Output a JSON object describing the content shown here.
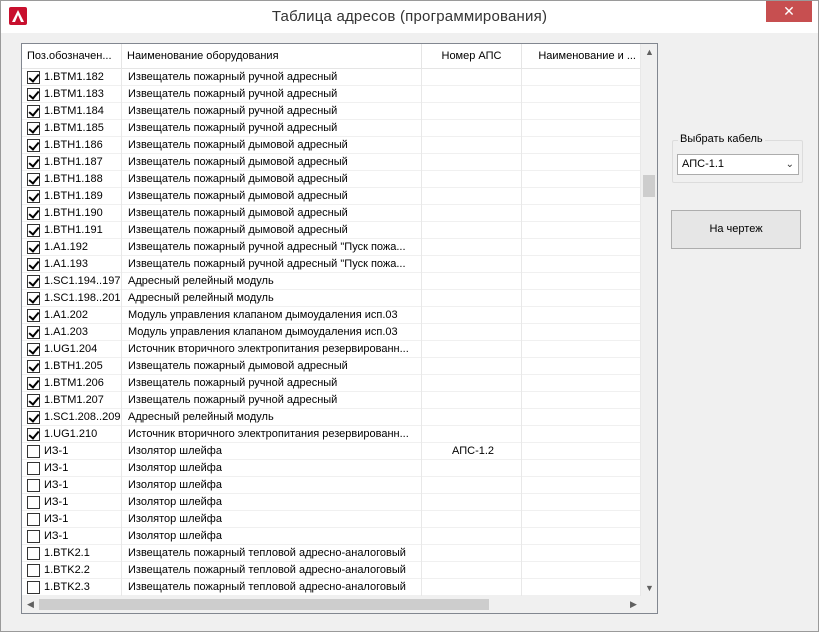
{
  "window": {
    "title": "Таблица адресов (программирования)",
    "close_glyph": "✕",
    "app_icon": "autocad-icon"
  },
  "columns": [
    "Поз.обозначен...",
    "Наименование оборудования",
    "Номер АПС",
    "Наименование и ..."
  ],
  "rows": [
    {
      "checked": true,
      "pos": "1.BTM1.182",
      "name": "Извещатель пожарный ручной адресный",
      "aps": "",
      "desc": ""
    },
    {
      "checked": true,
      "pos": "1.BTM1.183",
      "name": "Извещатель пожарный ручной адресный",
      "aps": "",
      "desc": ""
    },
    {
      "checked": true,
      "pos": "1.BTM1.184",
      "name": "Извещатель пожарный ручной адресный",
      "aps": "",
      "desc": ""
    },
    {
      "checked": true,
      "pos": "1.BTM1.185",
      "name": "Извещатель пожарный ручной адресный",
      "aps": "",
      "desc": ""
    },
    {
      "checked": true,
      "pos": "1.BTH1.186",
      "name": "Извещатель пожарный дымовой адресный",
      "aps": "",
      "desc": ""
    },
    {
      "checked": true,
      "pos": "1.BTH1.187",
      "name": "Извещатель пожарный дымовой адресный",
      "aps": "",
      "desc": ""
    },
    {
      "checked": true,
      "pos": "1.BTH1.188",
      "name": "Извещатель пожарный дымовой адресный",
      "aps": "",
      "desc": ""
    },
    {
      "checked": true,
      "pos": "1.BTH1.189",
      "name": "Извещатель пожарный дымовой адресный",
      "aps": "",
      "desc": ""
    },
    {
      "checked": true,
      "pos": "1.BTH1.190",
      "name": "Извещатель пожарный дымовой адресный",
      "aps": "",
      "desc": ""
    },
    {
      "checked": true,
      "pos": "1.BTH1.191",
      "name": "Извещатель пожарный дымовой адресный",
      "aps": "",
      "desc": ""
    },
    {
      "checked": true,
      "pos": "1.A1.192",
      "name": "Извещатель пожарный ручной адресный  \"Пуск пожа...",
      "aps": "",
      "desc": ""
    },
    {
      "checked": true,
      "pos": "1.A1.193",
      "name": "Извещатель пожарный ручной адресный  \"Пуск пожа...",
      "aps": "",
      "desc": ""
    },
    {
      "checked": true,
      "pos": "1.SC1.194..197",
      "name": "Адресный релейный модуль",
      "aps": "",
      "desc": ""
    },
    {
      "checked": true,
      "pos": "1.SC1.198..201",
      "name": "Адресный релейный модуль",
      "aps": "",
      "desc": ""
    },
    {
      "checked": true,
      "pos": "1.A1.202",
      "name": "Модуль управления клапаном дымоудаления исп.03",
      "aps": "",
      "desc": ""
    },
    {
      "checked": true,
      "pos": "1.A1.203",
      "name": "Модуль управления клапаном дымоудаления исп.03",
      "aps": "",
      "desc": ""
    },
    {
      "checked": true,
      "pos": "1.UG1.204",
      "name": "Источник вторичного электропитания резервированн...",
      "aps": "",
      "desc": ""
    },
    {
      "checked": true,
      "pos": "1.BTH1.205",
      "name": "Извещатель пожарный дымовой адресный",
      "aps": "",
      "desc": ""
    },
    {
      "checked": true,
      "pos": "1.BTM1.206",
      "name": "Извещатель пожарный ручной адресный",
      "aps": "",
      "desc": ""
    },
    {
      "checked": true,
      "pos": "1.BTM1.207",
      "name": "Извещатель пожарный ручной адресный",
      "aps": "",
      "desc": ""
    },
    {
      "checked": true,
      "pos": "1.SC1.208..209",
      "name": "Адресный релейный модуль",
      "aps": "",
      "desc": ""
    },
    {
      "checked": true,
      "pos": "1.UG1.210",
      "name": "Источник вторичного электропитания резервированн...",
      "aps": "",
      "desc": ""
    },
    {
      "checked": false,
      "pos": "ИЗ-1",
      "name": "Изолятор шлейфа",
      "aps": "АПС-1.2",
      "desc": ""
    },
    {
      "checked": false,
      "pos": "ИЗ-1",
      "name": "Изолятор шлейфа",
      "aps": "",
      "desc": ""
    },
    {
      "checked": false,
      "pos": "ИЗ-1",
      "name": "Изолятор шлейфа",
      "aps": "",
      "desc": ""
    },
    {
      "checked": false,
      "pos": "ИЗ-1",
      "name": "Изолятор шлейфа",
      "aps": "",
      "desc": ""
    },
    {
      "checked": false,
      "pos": "ИЗ-1",
      "name": "Изолятор шлейфа",
      "aps": "",
      "desc": ""
    },
    {
      "checked": false,
      "pos": "ИЗ-1",
      "name": "Изолятор шлейфа",
      "aps": "",
      "desc": ""
    },
    {
      "checked": false,
      "pos": "1.BTK2.1",
      "name": "Извещатель пожарный тепловой адресно-аналоговый",
      "aps": "",
      "desc": ""
    },
    {
      "checked": false,
      "pos": "1.BTK2.2",
      "name": "Извещатель пожарный тепловой адресно-аналоговый",
      "aps": "",
      "desc": ""
    },
    {
      "checked": false,
      "pos": "1.BTK2.3",
      "name": "Извещатель пожарный тепловой адресно-аналоговый",
      "aps": "",
      "desc": ""
    }
  ],
  "scroll": {
    "up": "▲",
    "down": "▼",
    "left": "◀",
    "right": "▶"
  },
  "cable_group": {
    "label": "Выбрать кабель",
    "selected": "АПС-1.1",
    "dropdown_glyph": "⌄"
  },
  "draw_button": {
    "label": "На чертеж"
  }
}
